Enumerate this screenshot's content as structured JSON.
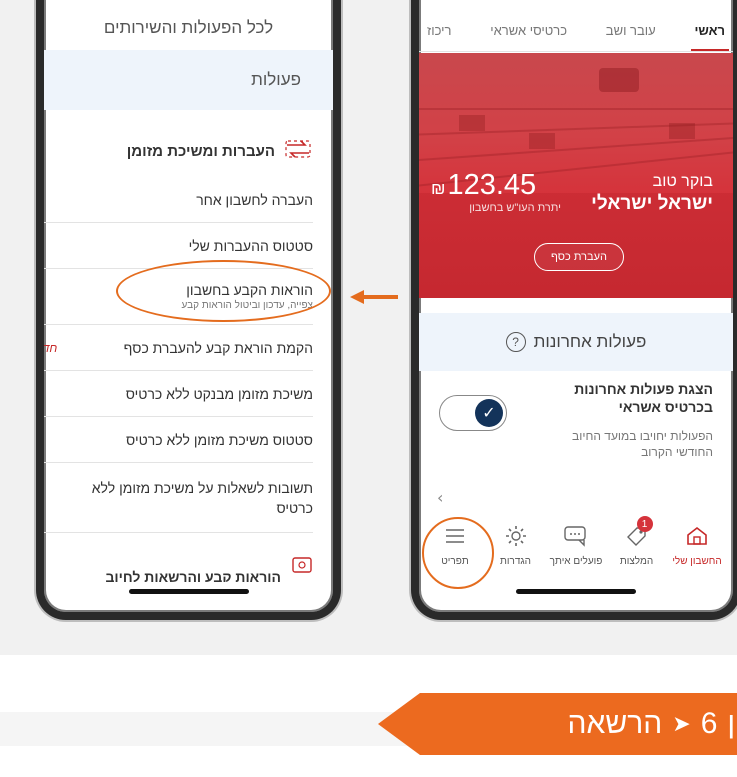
{
  "left_phone": {
    "header": "לכל הפעולות והשירותים",
    "section_title": "פעולות",
    "group_title": "העברות ומשיכת מזומן",
    "items": [
      {
        "label": "העברה לחשבון אחר"
      },
      {
        "label": "סטטוס ההעברות שלי"
      },
      {
        "label": "הוראות הקבע בחשבון",
        "sub": "צפייה, עדכון וביטול הוראות קבע"
      },
      {
        "label": "הקמת הוראת קבע להעברת כסף",
        "badge": "חדש"
      },
      {
        "label": "משיכת מזומן מבנקט ללא כרטיס"
      },
      {
        "label": "סטטוס משיכת מזומן ללא כרטיס"
      },
      {
        "label": "תשובות לשאלות על משיכת מזומן ללא כרטיס"
      }
    ],
    "next_group_title": "הוראות קבע והרשאות לחיוב"
  },
  "right_phone": {
    "tabs": [
      "ראשי",
      "עובר ושב",
      "כרטיסי אשראי",
      "ריכוז"
    ],
    "active_tab": "ראשי",
    "greeting": "בוקר טוב",
    "user_name": "ישראל ישראלי",
    "balance": "123.45",
    "currency": "₪",
    "balance_label": "יתרת העו\"ש בחשבון",
    "transfer_button": "העברת כסף",
    "recent_title": "פעולות אחרונות",
    "toggle_title": "הצגת פעולות אחרונות בכרטיס אשראי",
    "toggle_desc": "הפעולות יחויבו במועד החיוב החודשי הקרוב",
    "toggle_on": true,
    "nav": [
      {
        "label": "החשבון שלי",
        "icon": "home-icon",
        "active": true
      },
      {
        "label": "המלצות",
        "icon": "tag-icon",
        "badge": "1"
      },
      {
        "label": "פועלים איתך",
        "icon": "chat-icon"
      },
      {
        "label": "הגדרות",
        "icon": "gear-icon"
      },
      {
        "label": "תפריט",
        "icon": "menu-icon"
      }
    ]
  },
  "banner": {
    "prefix": "הרשאה",
    "number": "6",
    "suffix": "ון"
  },
  "colors": {
    "brand_red": "#d5333b",
    "highlight_orange": "#e46c1e",
    "banner_orange": "#ec6a1f",
    "navy": "#13335a"
  }
}
